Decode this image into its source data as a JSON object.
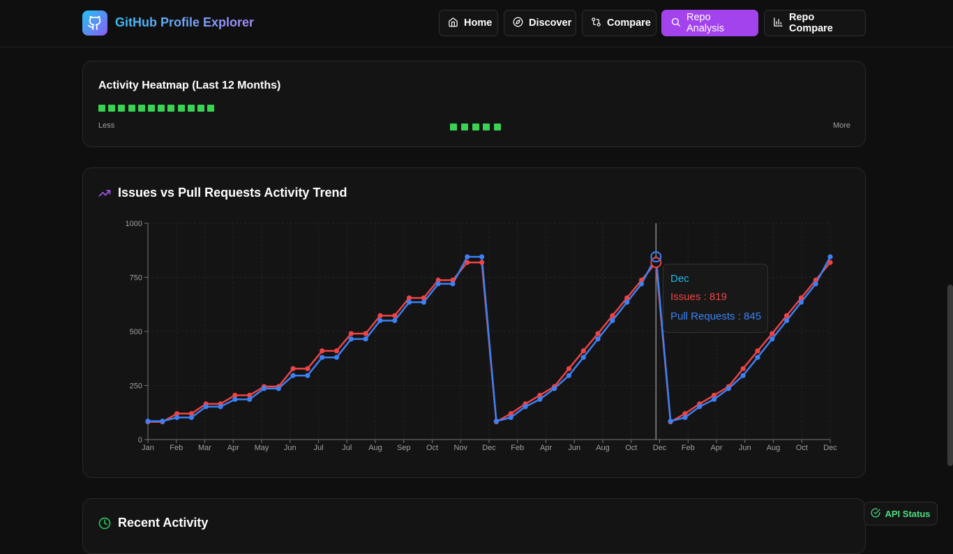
{
  "app": {
    "title": "GitHub Profile Explorer"
  },
  "nav": [
    {
      "label": "Home",
      "icon": "home-icon"
    },
    {
      "label": "Discover",
      "icon": "compass-icon"
    },
    {
      "label": "Compare",
      "icon": "git-compare-icon"
    },
    {
      "label": "Repo Analysis",
      "icon": "search-icon",
      "active": true
    },
    {
      "label": "Repo Compare",
      "icon": "bar-chart-icon"
    }
  ],
  "heatmap": {
    "title": "Activity Heatmap (Last 12 Months)",
    "less": "Less",
    "more": "More",
    "cell_count": 12,
    "legend_count": 5,
    "color": "#39d353"
  },
  "trend": {
    "title": "Issues vs Pull Requests Activity Trend",
    "icon": "trending-up-icon"
  },
  "tooltip": {
    "month": "Dec",
    "issues": "Issues : 819",
    "prs": "Pull Requests : 845"
  },
  "recent": {
    "title": "Recent Activity",
    "icon": "clock-icon"
  },
  "api_status": {
    "label": "API Status"
  },
  "colors": {
    "issues": "#ef4444",
    "prs": "#3b82f6",
    "accent": "#a343ee"
  },
  "chart_data": {
    "type": "line",
    "title": "Issues vs Pull Requests Activity Trend",
    "ylim": [
      0,
      1000
    ],
    "yticks": [
      0,
      250,
      500,
      750,
      1000
    ],
    "xticks": [
      "Jan",
      "Feb",
      "Mar",
      "Apr",
      "May",
      "Jun",
      "Jul",
      "Jul",
      "Aug",
      "Sep",
      "Oct",
      "Nov",
      "Dec",
      "Feb",
      "Apr",
      "Jun",
      "Aug",
      "Oct",
      "Dec",
      "Feb",
      "Apr",
      "Jun",
      "Aug",
      "Oct",
      "Dec"
    ],
    "x": [
      "Jan",
      "Jan",
      "Feb",
      "Feb",
      "Mar",
      "Mar",
      "Apr",
      "Apr",
      "May",
      "May",
      "Jun",
      "Jun",
      "Jul",
      "Jul",
      "Aug",
      "Aug",
      "Sep",
      "Sep",
      "Oct",
      "Oct",
      "Nov",
      "Nov",
      "Dec",
      "Dec",
      "Jan",
      "Feb",
      "Mar",
      "Apr",
      "May",
      "Jun",
      "Jul",
      "Aug",
      "Sep",
      "Oct",
      "Nov",
      "Dec",
      "Jan",
      "Feb",
      "Mar",
      "Apr",
      "May",
      "Jun",
      "Jul",
      "Aug",
      "Sep",
      "Oct",
      "Nov",
      "Dec"
    ],
    "series": [
      {
        "name": "Issues",
        "values": [
          82,
          82,
          120,
          120,
          165,
          165,
          205,
          205,
          245,
          245,
          328,
          328,
          410,
          410,
          490,
          490,
          573,
          573,
          655,
          655,
          737,
          737,
          819,
          819,
          82,
          120,
          165,
          205,
          245,
          328,
          410,
          490,
          573,
          655,
          737,
          819,
          82,
          120,
          165,
          205,
          245,
          328,
          410,
          490,
          573,
          655,
          737,
          819
        ]
      },
      {
        "name": "Pull Requests",
        "values": [
          85,
          85,
          102,
          102,
          152,
          152,
          186,
          186,
          236,
          236,
          296,
          296,
          380,
          380,
          465,
          465,
          550,
          550,
          635,
          635,
          720,
          720,
          845,
          845,
          85,
          102,
          152,
          186,
          236,
          296,
          380,
          465,
          550,
          635,
          720,
          845,
          85,
          102,
          152,
          186,
          236,
          296,
          380,
          465,
          550,
          635,
          720,
          845
        ]
      }
    ],
    "grid": true,
    "tooltip_index": 35
  }
}
